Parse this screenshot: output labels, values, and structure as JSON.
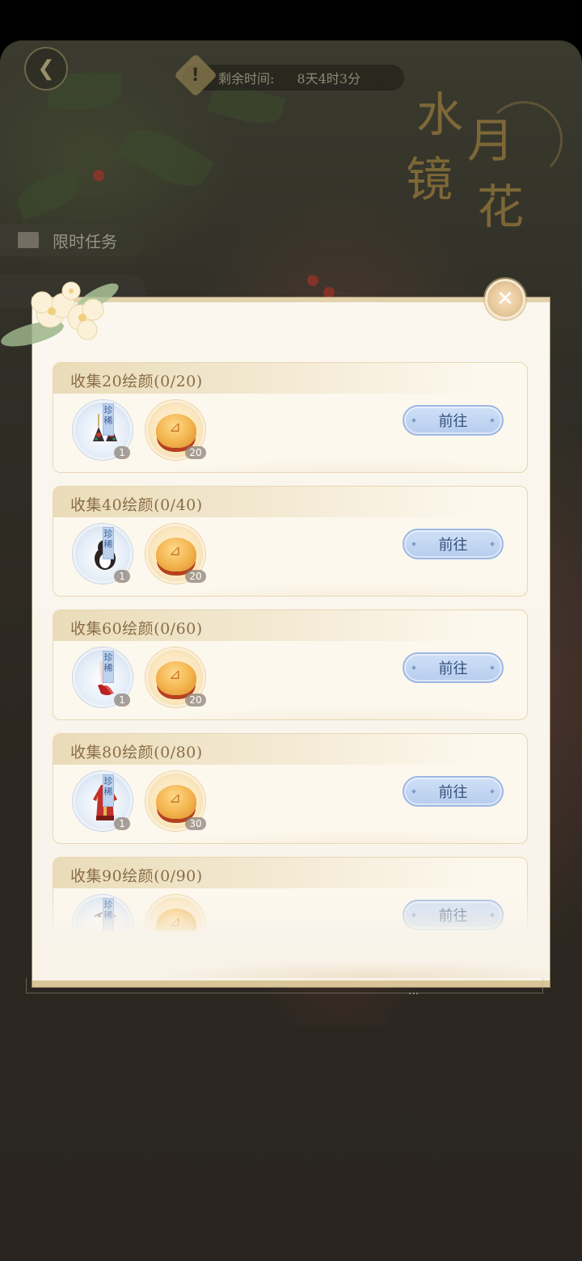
{
  "header": {
    "timer_label": "剩余时间:",
    "timer_value": "8天4时3分",
    "timer_icon": "!"
  },
  "title_art": {
    "chars": [
      "水",
      "月",
      "镜",
      "花"
    ]
  },
  "side_tabs": [
    {
      "label": "限时任务"
    }
  ],
  "modal": {
    "close_icon": "✕",
    "more": "...",
    "tasks": [
      {
        "title": "收集20绘颜(0/20)",
        "rare_tag": "珍稀",
        "item_qty": "1",
        "coin_qty": "20",
        "button": "前往",
        "item": "earrings"
      },
      {
        "title": "收集40绘颜(0/40)",
        "rare_tag": "珍稀",
        "item_qty": "1",
        "coin_qty": "20",
        "button": "前往",
        "item": "hairstyle"
      },
      {
        "title": "收集60绘颜(0/60)",
        "rare_tag": "珍稀",
        "item_qty": "1",
        "coin_qty": "20",
        "button": "前往",
        "item": "shoes"
      },
      {
        "title": "收集80绘颜(0/80)",
        "rare_tag": "珍稀",
        "item_qty": "1",
        "coin_qty": "30",
        "button": "前往",
        "item": "robe"
      },
      {
        "title": "收集90绘颜(0/90)",
        "rare_tag": "珍稀",
        "item_qty": "",
        "coin_qty": "",
        "button": "前往",
        "item": "accessory"
      }
    ]
  },
  "colors": {
    "modal_bg": "#f8f3ea",
    "card_title": "#8a6d45",
    "button_bg": "#c4d8f2",
    "button_text": "#35517d",
    "rare_tag": "#bcd2ee"
  }
}
